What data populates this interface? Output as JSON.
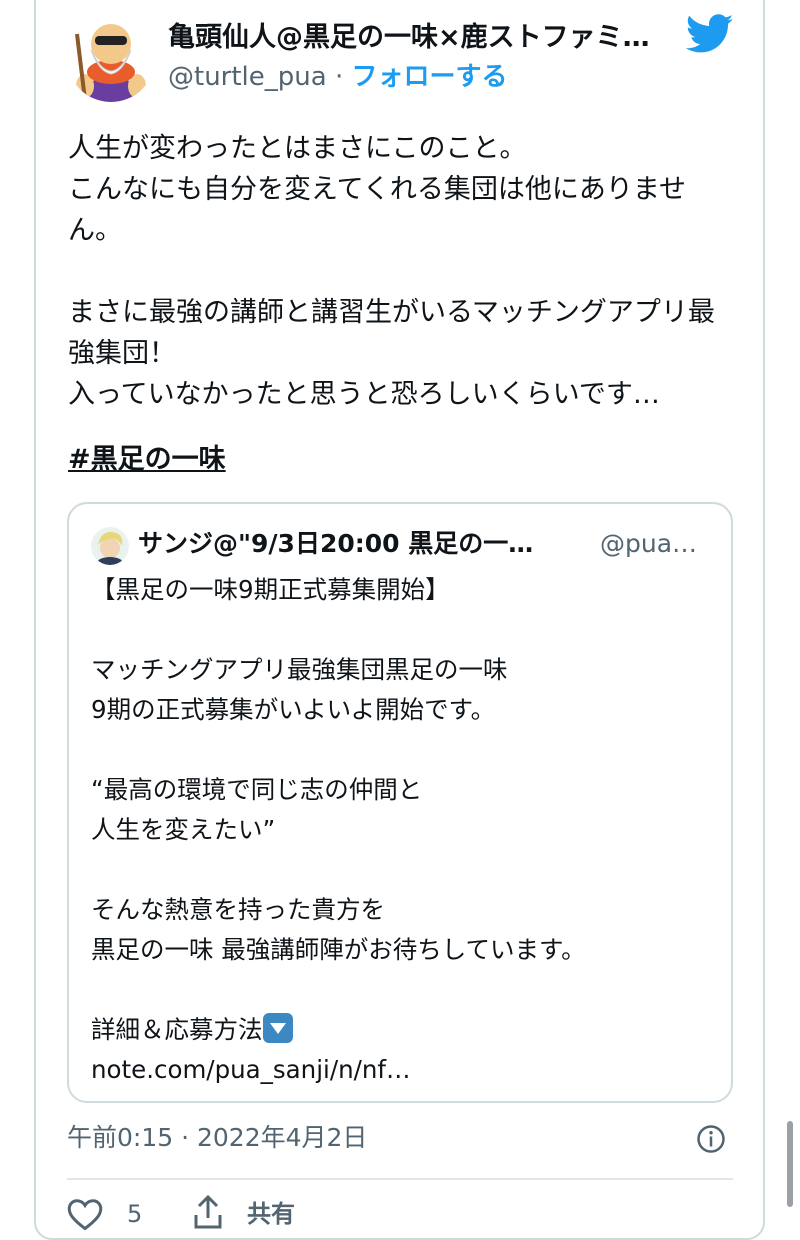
{
  "tweet": {
    "author": {
      "display_name": "亀頭仙人@黒足の一味×鹿ストファミ…",
      "handle": "@turtle_pua",
      "separator": "·",
      "follow_label": "フォローする"
    },
    "body": "人生が変わったとはまさにこのこと。\nこんなにも自分を変えてくれる集団は他にありませ\nん。\n\nまさに最強の講師と講習生がいるマッチングアプリ最\n強集団！\n入っていなかったと思うと恐ろしいくらいです…",
    "hashtag": "#黒足の一味",
    "quote": {
      "display_name": "サンジ@\"9/3日20:00 黒足の一…",
      "handle": "@pua…",
      "text_main": "【黒足の一味9期正式募集開始】\n\nマッチングアプリ最強集団黒足の一味\n9期の正式募集がいよいよ開始です。\n\n“最高の環境で同じ志の仲間と\n人生を変えたい”\n\nそんな熱意を持った貴方を\n黒足の一味 最強講師陣がお待ちしています。\n\n",
      "details_label": "詳細＆応募方法",
      "link": "note.com/pua_sanji/n/nf…"
    },
    "timestamp": "午前0:15 · 2022年4月2日",
    "actions": {
      "like_count": "5",
      "share_label": "共有"
    }
  },
  "colors": {
    "accent": "#1d9bf0",
    "text": "#0f1419",
    "secondary_text": "#536471",
    "border": "#cfd9de"
  },
  "icons": [
    "twitter-bird-icon",
    "info-icon",
    "heart-icon",
    "share-icon",
    "down-arrow-emoji-icon"
  ]
}
